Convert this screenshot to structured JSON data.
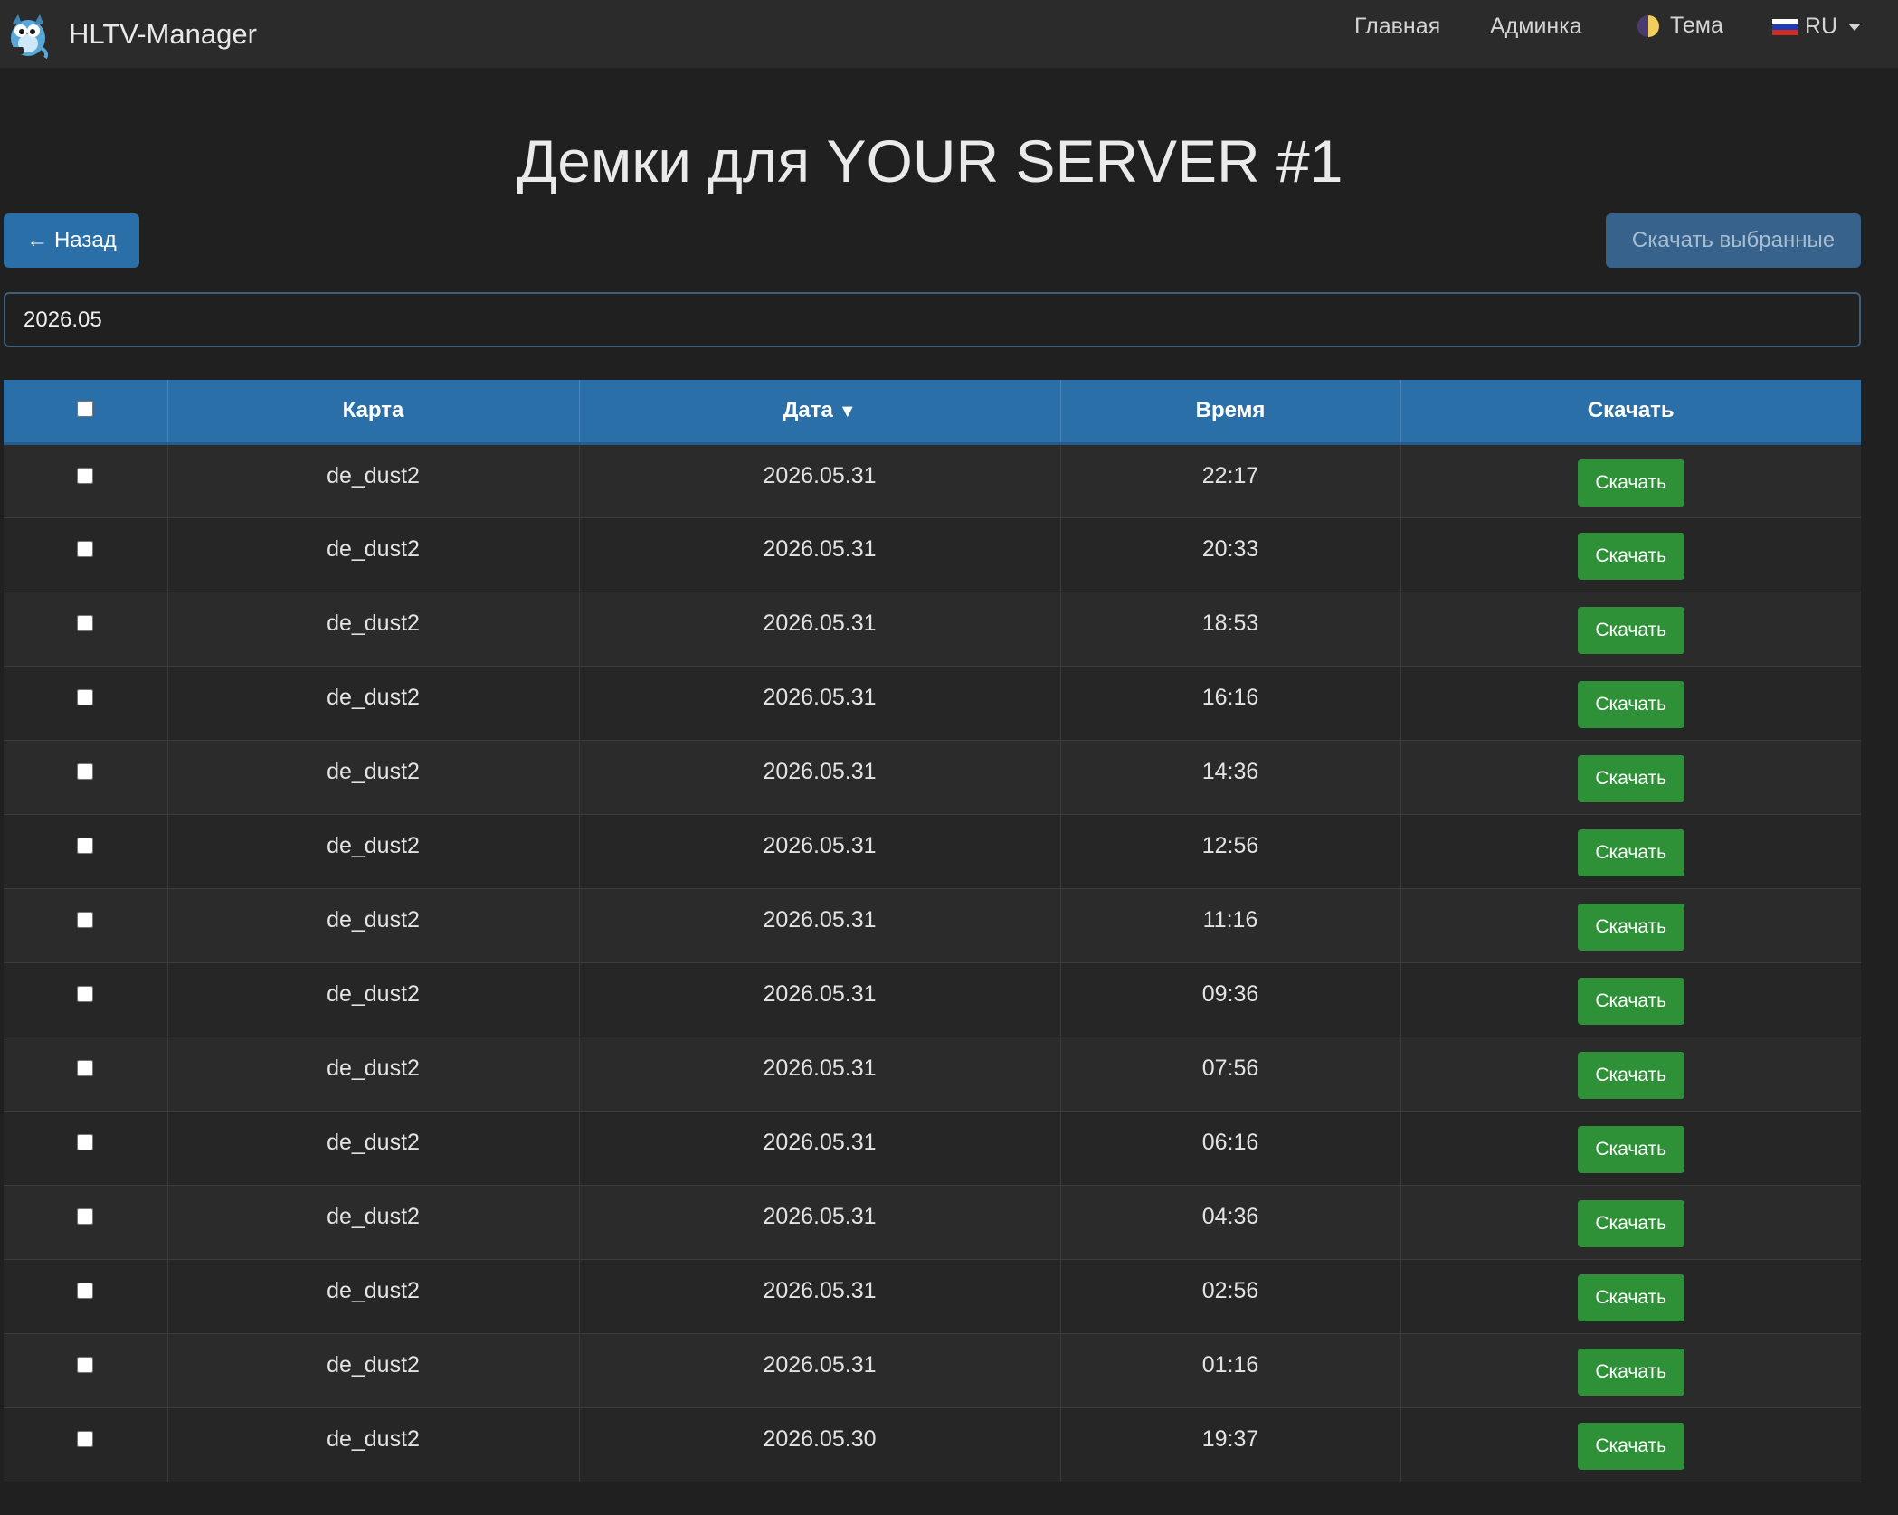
{
  "navbar": {
    "brand": "HLTV-Manager",
    "home": "Главная",
    "admin": "Админка",
    "theme": "Тема",
    "lang": "RU"
  },
  "page": {
    "title": "Демки для YOUR SERVER #1",
    "back_button": "← Назад",
    "download_selected": "Скачать выбранные",
    "search_value": "2026.05"
  },
  "table": {
    "headers": {
      "map": "Карта",
      "date": "Дата",
      "date_sort": "▼",
      "time": "Время",
      "download": "Скачать"
    },
    "rows": [
      {
        "map": "de_dust2",
        "date": "2026.05.31",
        "time": "22:17",
        "action": "Скачать"
      },
      {
        "map": "de_dust2",
        "date": "2026.05.31",
        "time": "20:33",
        "action": "Скачать"
      },
      {
        "map": "de_dust2",
        "date": "2026.05.31",
        "time": "18:53",
        "action": "Скачать"
      },
      {
        "map": "de_dust2",
        "date": "2026.05.31",
        "time": "16:16",
        "action": "Скачать"
      },
      {
        "map": "de_dust2",
        "date": "2026.05.31",
        "time": "14:36",
        "action": "Скачать"
      },
      {
        "map": "de_dust2",
        "date": "2026.05.31",
        "time": "12:56",
        "action": "Скачать"
      },
      {
        "map": "de_dust2",
        "date": "2026.05.31",
        "time": "11:16",
        "action": "Скачать"
      },
      {
        "map": "de_dust2",
        "date": "2026.05.31",
        "time": "09:36",
        "action": "Скачать"
      },
      {
        "map": "de_dust2",
        "date": "2026.05.31",
        "time": "07:56",
        "action": "Скачать"
      },
      {
        "map": "de_dust2",
        "date": "2026.05.31",
        "time": "06:16",
        "action": "Скачать"
      },
      {
        "map": "de_dust2",
        "date": "2026.05.31",
        "time": "04:36",
        "action": "Скачать"
      },
      {
        "map": "de_dust2",
        "date": "2026.05.31",
        "time": "02:56",
        "action": "Скачать"
      },
      {
        "map": "de_dust2",
        "date": "2026.05.31",
        "time": "01:16",
        "action": "Скачать"
      },
      {
        "map": "de_dust2",
        "date": "2026.05.30",
        "time": "19:37",
        "action": "Скачать"
      }
    ]
  },
  "colors": {
    "primary": "#2b6fa9",
    "success": "#2e9138",
    "background": "#202020",
    "navbar": "#2b2b2b"
  },
  "icons": [
    "app-logo-icon",
    "theme-icon",
    "flag-ru-icon",
    "caret-down-icon",
    "sort-desc-icon"
  ]
}
